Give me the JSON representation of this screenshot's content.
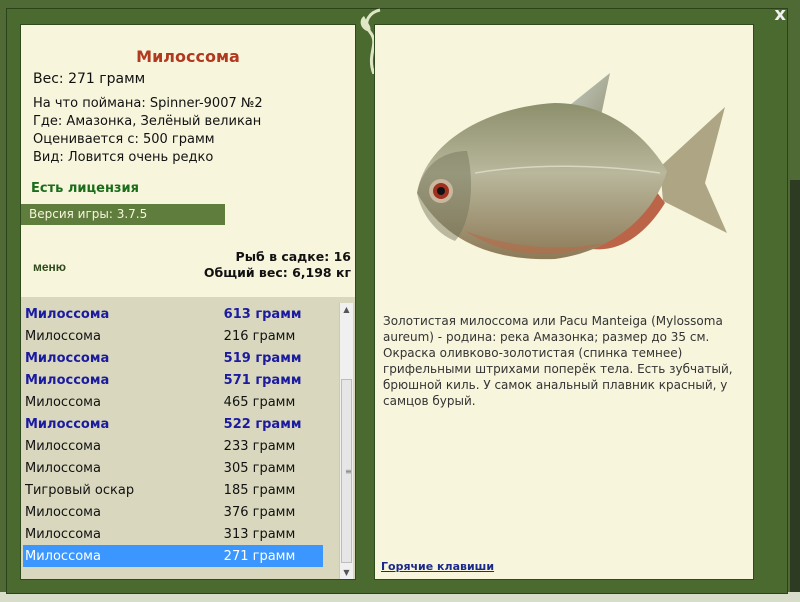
{
  "window": {
    "close_label": "x"
  },
  "fish": {
    "name": "Милоссома",
    "weight": "Вес: 271 грамм",
    "caught_with": "На что поймана: Spinner-9007 №2",
    "location": "Где: Амазонка, Зелёный великан",
    "valued_from": "Оценивается с: 500 грамм",
    "rarity": "Вид: Ловится очень редко"
  },
  "license": "Есть лицензия",
  "version": "Версия игры: 3.7.5",
  "menu_label": "меню",
  "stats": {
    "fish_in_keepnet": "Рыб в садке: 16",
    "total_weight": "Общий вес: 6,198 кг"
  },
  "catch_list": [
    {
      "name": "Милоссома",
      "weight": "613 грамм",
      "big": true
    },
    {
      "name": "Милоссома",
      "weight": "216 грамм",
      "big": false
    },
    {
      "name": "Милоссома",
      "weight": "519 грамм",
      "big": true
    },
    {
      "name": "Милоссома",
      "weight": "571 грамм",
      "big": true
    },
    {
      "name": "Милоссома",
      "weight": "465 грамм",
      "big": false
    },
    {
      "name": "Милоссома",
      "weight": "522 грамм",
      "big": true
    },
    {
      "name": "Милоссома",
      "weight": "233 грамм",
      "big": false
    },
    {
      "name": "Милоссома",
      "weight": "305 грамм",
      "big": false
    },
    {
      "name": "Тигровый оскар",
      "weight": "185 грамм",
      "big": false
    },
    {
      "name": "Милоссома",
      "weight": "376 грамм",
      "big": false
    },
    {
      "name": "Милоссома",
      "weight": "313 грамм",
      "big": false
    },
    {
      "name": "Милоссома",
      "weight": "271 грамм",
      "big": false,
      "selected": true
    }
  ],
  "description": "Золотистая милоссома или Pacu Manteiga (Mylossoma aureum) - родина: река Амазонка; размер до 35 см. Окраска оливково-золотистая (спинка темнее) грифельными штрихами поперёк тела. Есть зубчатый, брюшной киль. У самок анальный плавник красный, у самцов бурый.",
  "hotkeys_label": "Горячие клавиши",
  "colors": {
    "frame": "#4b6a2f",
    "panel": "#f8f5dd",
    "title_red": "#b0391f",
    "license_green": "#1b6d1b",
    "big_fish_blue": "#1b1ba0",
    "selection": "#3b96ff"
  }
}
